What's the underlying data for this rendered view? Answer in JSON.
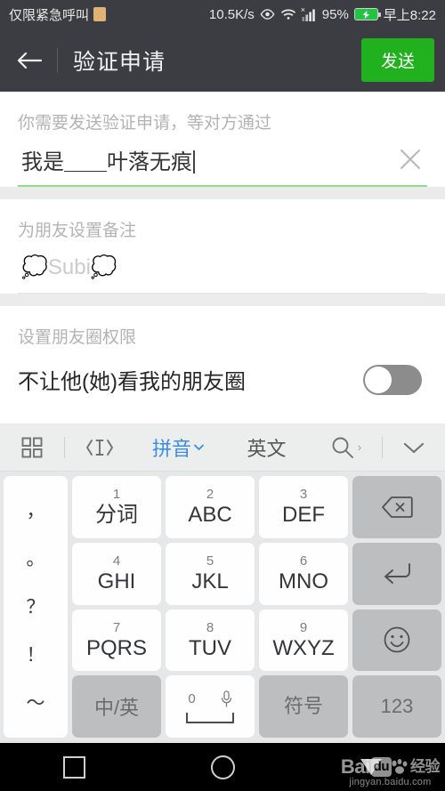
{
  "statusbar": {
    "carrier": "仅限紧急呼叫",
    "network_speed": "10.5K/s",
    "battery_percent": "95%",
    "time": "早上8:22",
    "icons": [
      "sim-card-icon",
      "eye-icon",
      "wifi-icon",
      "signal-bars-icon",
      "battery-charging-icon"
    ]
  },
  "header": {
    "back_label": "back-arrow",
    "title": "验证申请",
    "send_label": "发送",
    "send_color": "#22b11e"
  },
  "form": {
    "verify": {
      "label": "你需要发送验证申请，等对方通过",
      "value": "我是＿＿叶落无痕",
      "clear_label": "清除",
      "underline_color": "#8fdd8b"
    },
    "remark": {
      "label": "为朋友设置备注",
      "placeholder": "💭Subi💭",
      "value": ""
    },
    "moments": {
      "label": "设置朋友圈权限",
      "row_label": "不让他(她)看我的朋友圈",
      "toggle_state": "off"
    }
  },
  "keyboard": {
    "toolbar": {
      "grid_icon": "grid-icon",
      "cursor_icon": "cursor-move-icon",
      "pinyin": "拼音",
      "english": "英文",
      "search_icon": "search-icon",
      "more_arrow": "›",
      "collapse_icon": "chevron-down-icon",
      "active_mode": "拼音",
      "active_color": "#3a8ee6"
    },
    "punctuation": [
      "，",
      "。",
      "？",
      "！",
      "～"
    ],
    "keys": [
      {
        "num": "1",
        "main": "分词",
        "type": "letter"
      },
      {
        "num": "2",
        "main": "ABC",
        "type": "letter"
      },
      {
        "num": "3",
        "main": "DEF",
        "type": "letter"
      },
      {
        "num": "",
        "main": "",
        "type": "backspace",
        "icon": "backspace-icon"
      },
      {
        "num": "4",
        "main": "GHI",
        "type": "letter"
      },
      {
        "num": "5",
        "main": "JKL",
        "type": "letter"
      },
      {
        "num": "6",
        "main": "MNO",
        "type": "letter"
      },
      {
        "num": "",
        "main": "",
        "type": "enter",
        "icon": "enter-icon"
      },
      {
        "num": "7",
        "main": "PQRS",
        "type": "letter"
      },
      {
        "num": "8",
        "main": "TUV",
        "type": "letter"
      },
      {
        "num": "9",
        "main": "WXYZ",
        "type": "letter"
      },
      {
        "num": "",
        "main": "",
        "type": "emoji",
        "icon": "smiley-icon"
      },
      {
        "num": "",
        "main": "中/英",
        "type": "lang"
      },
      {
        "num": "0",
        "main": "",
        "type": "space",
        "icon": "microphone-icon"
      },
      {
        "num": "",
        "main": "符号",
        "type": "symbols"
      },
      {
        "num": "",
        "main": "123",
        "type": "numbers"
      }
    ]
  },
  "navbar": {
    "recents": "square-icon",
    "home": "circle-icon",
    "back": "triangle-down-icon"
  },
  "watermark": {
    "brand": "Bai",
    "du": "du",
    "suffix": "经验",
    "url": "jingyan.baidu.com"
  }
}
